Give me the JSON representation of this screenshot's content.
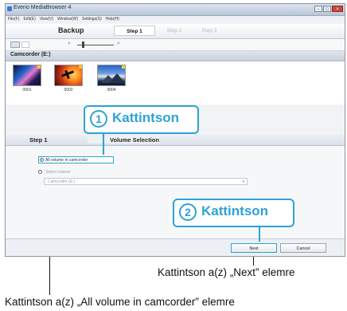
{
  "window": {
    "title": "Everio MediaBrowser 4",
    "controls": [
      "-",
      "□",
      "×"
    ]
  },
  "menu": [
    "File(F)",
    "Edit(E)",
    "View(V)",
    "Window(W)",
    "Settings(S)",
    "Help(H)"
  ],
  "header": {
    "mode": "Backup",
    "steps": [
      "Step 1",
      "Step 2",
      "Step 3"
    ]
  },
  "toolbar": {
    "view_icons": [
      "thumbnail-view-icon",
      "list-view-icon"
    ],
    "zoom_icons": [
      "zoom-out-icon",
      "zoom-in-icon"
    ]
  },
  "source": {
    "label": "Camcorder (E:)",
    "thumbnails": [
      {
        "label": "0001"
      },
      {
        "label": "0002"
      },
      {
        "label": "0004"
      }
    ]
  },
  "callouts": {
    "one": {
      "num": "1",
      "text": "Kattintson"
    },
    "two": {
      "num": "2",
      "text": "Kattintson"
    }
  },
  "steppanel": {
    "step": "Step 1",
    "title": "Volume Selection",
    "option1": "All volume in camcorder",
    "option2": "Select volume",
    "dropdown": "Camcorder (E:)",
    "dropdown_arrow": "▾"
  },
  "buttons": {
    "next": "Next",
    "cancel": "Cancel"
  },
  "captions": {
    "next": "Kattintson a(z) „Next” elemre",
    "all": "Kattintson a(z) „All volume in camcorder” elemre"
  },
  "colors": {
    "accent": "#2fa2d4"
  }
}
